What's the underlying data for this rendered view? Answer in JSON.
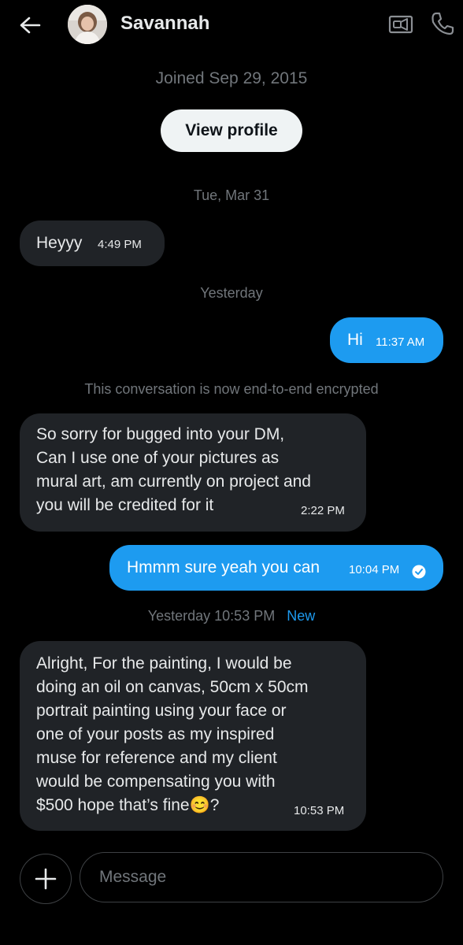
{
  "header": {
    "back_icon": "arrow-left-icon",
    "name": "Savannah",
    "video_icon": "video-camera-icon",
    "call_icon": "phone-icon"
  },
  "profile": {
    "joined": "Joined Sep 29, 2015",
    "view_profile_label": "View profile"
  },
  "separators": {
    "first": "Tue, Mar 31",
    "second": "Yesterday",
    "encrypted_notice": "This conversation is now end-to-end encrypted",
    "new_time": "Yesterday 10:53 PM",
    "new_label": "New"
  },
  "messages": [
    {
      "direction": "in",
      "text": "Heyyy",
      "time": "4:49 PM"
    },
    {
      "direction": "out",
      "text": "Hi",
      "time": "11:37 AM"
    },
    {
      "direction": "in",
      "lines": [
        "So sorry for bugged into your DM,",
        "Can I use one of your pictures as",
        "mural art, am currently on project and",
        "you will be credited for it"
      ],
      "time": "2:22 PM"
    },
    {
      "direction": "out",
      "text": "Hmmm sure yeah you can",
      "time": "10:04 PM",
      "status_icon": "read-check-icon"
    },
    {
      "direction": "in",
      "lines": [
        "Alright, For the painting, I would be",
        "doing an oil on canvas, 50cm x 50cm",
        "portrait painting using your face or",
        "one of your posts as my inspired",
        "muse for reference and my client",
        "would be compensating you with",
        "$500 hope that’s fine"
      ],
      "last_line_suffix": "?",
      "emoji": "😊",
      "time": "10:53 PM"
    }
  ],
  "composer": {
    "plus_icon": "plus-icon",
    "placeholder": "Message"
  },
  "colors": {
    "background": "#000000",
    "incoming_bubble": "#202327",
    "outgoing_bubble": "#1d9bf0",
    "muted_text": "#71767b",
    "accent": "#1d9bf0"
  }
}
